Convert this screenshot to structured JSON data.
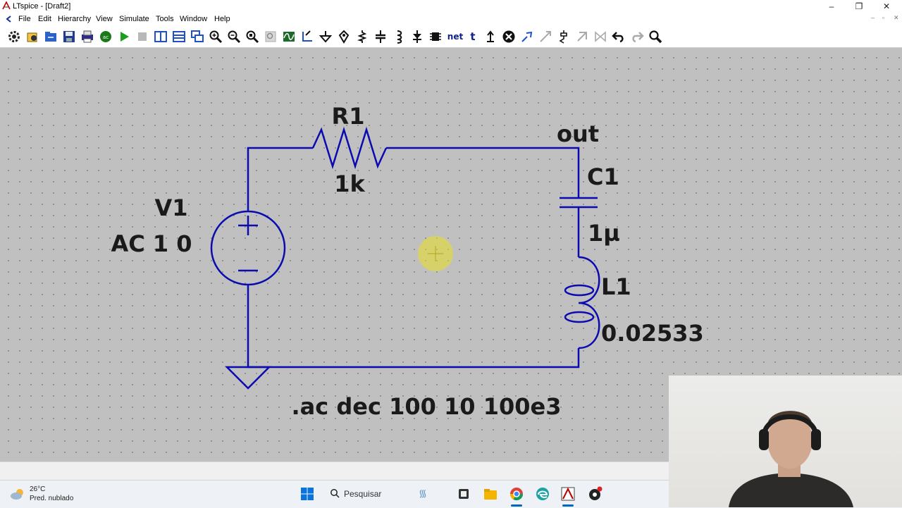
{
  "window": {
    "title": "LTspice - [Draft2]"
  },
  "window_controls": {
    "minimize": "–",
    "maximize": "❐",
    "close": "✕"
  },
  "menu": [
    "File",
    "Edit",
    "Hierarchy",
    "View",
    "Simulate",
    "Tools",
    "Window",
    "Help"
  ],
  "mdi_controls": {
    "minimize": "–",
    "restore": "▫",
    "close": "✕"
  },
  "toolbar": {
    "net_label": "net",
    "text_label": "t",
    "buttons": [
      "control-panel",
      "open",
      "new-schematic",
      "save",
      "print",
      "ac-analysis",
      "run",
      "halt",
      "tile-vertical",
      "tile-horizontal",
      "cascade",
      "zoom-in",
      "zoom-out",
      "zoom-fit",
      "zoom-back",
      "autorange",
      "wire",
      "ground",
      "label",
      "resistor",
      "capacitor",
      "inductor",
      "diode",
      "component",
      "net-label",
      "text",
      "spice-directive",
      "delete",
      "duplicate",
      "move",
      "drag",
      "undo",
      "redo",
      "find"
    ]
  },
  "schematic": {
    "r1": {
      "name": "R1",
      "value": "1k"
    },
    "v1": {
      "name": "V1",
      "value": "AC 1 0"
    },
    "c1": {
      "name": "C1",
      "value": "1µ"
    },
    "l1": {
      "name": "L1",
      "value": "0.02533"
    },
    "node_label": "out",
    "directive": ".ac dec 100 10 100e3"
  },
  "colors": {
    "wire": "#0b0bb0",
    "canvas": "#c0c0c0",
    "text": "#1a1a1a",
    "cursor_highlight": "#f2e600"
  },
  "taskbar": {
    "weather_temp": "26°C",
    "weather_desc": "Pred. nublado",
    "search_placeholder": "Pesquisar",
    "apps": [
      "start-icon",
      "search-icon",
      "file-explorer-icon",
      "chrome-icon",
      "edge-icon",
      "ltspice-icon",
      "obs-icon"
    ]
  }
}
